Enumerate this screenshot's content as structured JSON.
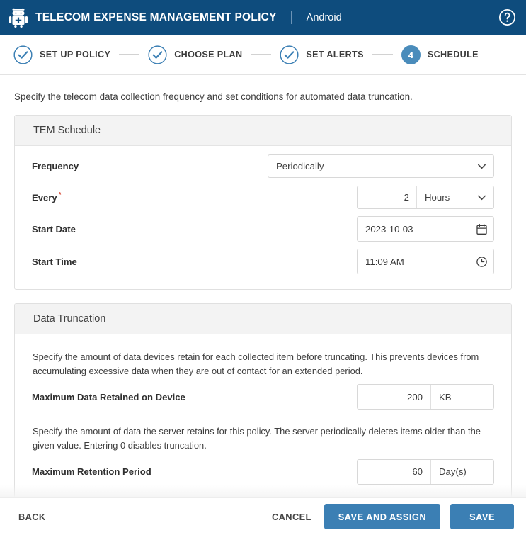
{
  "header": {
    "app_icon": "android-robot-icon",
    "title": "TELECOM EXPENSE MANAGEMENT POLICY",
    "platform": "Android",
    "help_icon": "help-circle-icon",
    "bar_color": "#0e4c7d"
  },
  "stepper": {
    "steps": [
      {
        "label": "SET UP POLICY",
        "state": "complete",
        "number": "1"
      },
      {
        "label": "CHOOSE PLAN",
        "state": "complete",
        "number": "2"
      },
      {
        "label": "SET ALERTS",
        "state": "complete",
        "number": "3"
      },
      {
        "label": "SCHEDULE",
        "state": "active",
        "number": "4"
      }
    ],
    "active_color": "#4a8cbb",
    "check_color": "#3b7fb4"
  },
  "main": {
    "intro": "Specify the telecom data collection frequency and set conditions for automated data truncation.",
    "schedule_card": {
      "title": "TEM Schedule",
      "frequency": {
        "label": "Frequency",
        "value": "Periodically",
        "chevron_icon": "chevron-down-icon"
      },
      "every": {
        "label": "Every",
        "required_marker": "*",
        "value": "2",
        "unit": "Hours",
        "chevron_icon": "chevron-down-icon"
      },
      "start_date": {
        "label": "Start Date",
        "value": "2023-10-03",
        "icon": "calendar-icon"
      },
      "start_time": {
        "label": "Start Time",
        "value": "11:09 AM",
        "icon": "clock-icon"
      }
    },
    "truncation_card": {
      "title": "Data Truncation",
      "device_paragraph": "Specify the amount of data devices retain for each collected item before truncating. This prevents devices from accumulating excessive data when they are out of contact for an extended period.",
      "max_data": {
        "label": "Maximum Data Retained on Device",
        "value": "200",
        "unit": "KB"
      },
      "server_paragraph": "Specify the amount of data the server retains for this policy. The server periodically deletes items older than the given value. Entering 0 disables truncation.",
      "max_retention": {
        "label": "Maximum Retention Period",
        "value": "60",
        "unit": "Day(s)"
      }
    }
  },
  "footer": {
    "back": "BACK",
    "cancel": "CANCEL",
    "save_and_assign": "SAVE AND ASSIGN",
    "save": "SAVE",
    "primary_color": "#3b7fb4"
  }
}
